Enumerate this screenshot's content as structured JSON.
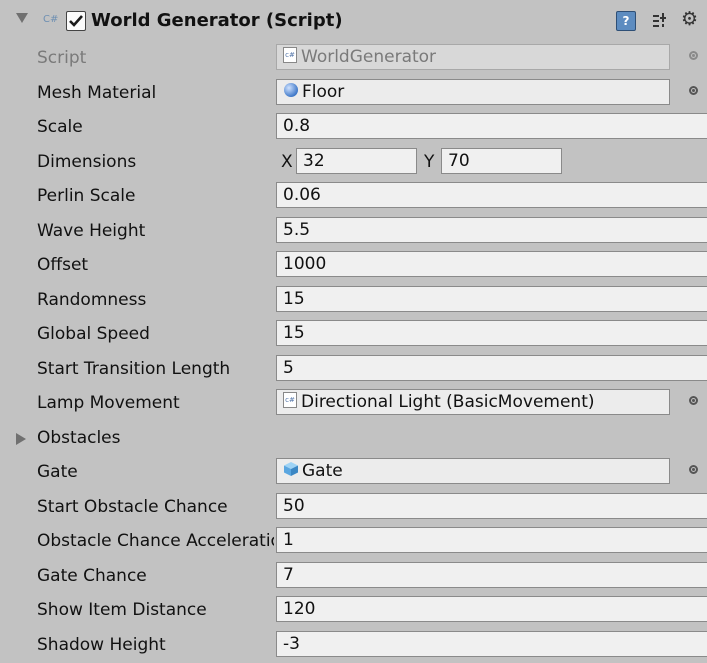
{
  "component": {
    "title": "World Generator (Script)",
    "cs_badge": "C#",
    "help_glyph": "?",
    "gear_glyph": "⚙",
    "enabled": true
  },
  "fields": [
    {
      "key": "script",
      "label": "Script",
      "value": "WorldGenerator",
      "kind": "object",
      "icon": "cs-script-icon",
      "disabled": true
    },
    {
      "key": "mesh_material",
      "label": "Mesh Material",
      "value": "Floor",
      "kind": "object",
      "icon": "material-sphere-icon"
    },
    {
      "key": "scale",
      "label": "Scale",
      "value": "0.8",
      "kind": "text"
    },
    {
      "key": "dimensions",
      "label": "Dimensions",
      "kind": "vector2",
      "x_label": "X",
      "x_value": "32",
      "y_label": "Y",
      "y_value": "70"
    },
    {
      "key": "perlin_scale",
      "label": "Perlin Scale",
      "value": "0.06",
      "kind": "text"
    },
    {
      "key": "wave_height",
      "label": "Wave Height",
      "value": "5.5",
      "kind": "text"
    },
    {
      "key": "offset",
      "label": "Offset",
      "value": "1000",
      "kind": "text"
    },
    {
      "key": "randomness",
      "label": "Randomness",
      "value": "15",
      "kind": "text"
    },
    {
      "key": "global_speed",
      "label": "Global Speed",
      "value": "15",
      "kind": "text"
    },
    {
      "key": "start_transition_length",
      "label": "Start Transition Length",
      "value": "5",
      "kind": "text"
    },
    {
      "key": "lamp_movement",
      "label": "Lamp Movement",
      "value": "Directional Light (BasicMovement)",
      "kind": "object",
      "icon": "cs-script-icon"
    },
    {
      "key": "obstacles",
      "label": "Obstacles",
      "kind": "foldout"
    },
    {
      "key": "gate",
      "label": "Gate",
      "value": "Gate",
      "kind": "object",
      "icon": "prefab-cube-icon"
    },
    {
      "key": "start_obstacle_chance",
      "label": "Start Obstacle Chance",
      "value": "50",
      "kind": "text"
    },
    {
      "key": "obstacle_chance_accel",
      "label": "Obstacle Chance Acceleration",
      "value": "1",
      "kind": "text"
    },
    {
      "key": "gate_chance",
      "label": "Gate Chance",
      "value": "7",
      "kind": "text"
    },
    {
      "key": "show_item_distance",
      "label": "Show Item Distance",
      "value": "120",
      "kind": "text"
    },
    {
      "key": "shadow_height",
      "label": "Shadow Height",
      "value": "-3",
      "kind": "text"
    }
  ],
  "colors": {
    "background": "#c2c2c2",
    "field": "#f0f0f0",
    "help_icon": "#5d8cc0",
    "material_sphere": "#3f78c8",
    "prefab_cube": "#5aa6e0"
  }
}
